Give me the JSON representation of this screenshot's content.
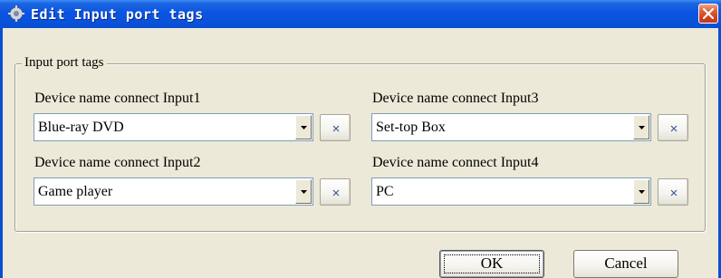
{
  "dialog": {
    "title": "Edit Input port tags",
    "group_title": "Input port tags",
    "inputs": [
      {
        "label": "Device name connect Input1",
        "value": "Blue-ray DVD"
      },
      {
        "label": "Device name connect Input2",
        "value": "Game player"
      },
      {
        "label": "Device name connect Input3",
        "value": "Set-top Box"
      },
      {
        "label": "Device name connect Input4",
        "value": "PC"
      }
    ],
    "clear_button_glyph": "×",
    "ok_label": "OK",
    "cancel_label": "Cancel"
  },
  "icons": {
    "app": "gear-icon",
    "close": "close-icon",
    "dropdown": "chevron-down-icon",
    "clear": "clear-x-icon"
  },
  "colors": {
    "titlebar": "#0a54e3",
    "dialog_bg": "#ece9d8",
    "close_button": "#d4411e",
    "field_border": "#7f9db9"
  }
}
